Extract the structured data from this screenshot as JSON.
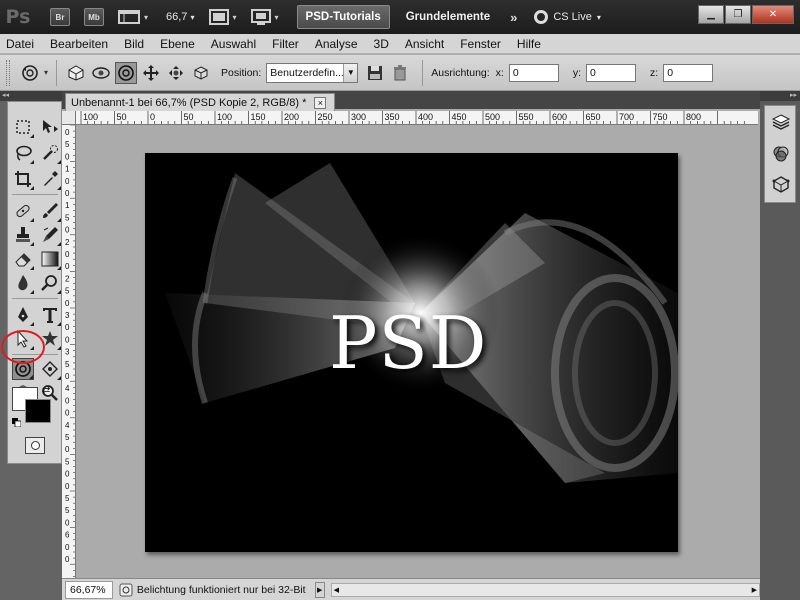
{
  "appbar": {
    "logo": "Ps",
    "bridge_label": "Br",
    "minibridge_label": "Mb",
    "zoom": "66,7",
    "workspace_active": "PSD-Tutorials",
    "workspace_next": "Grundelemente",
    "more": "»",
    "cslive": "CS Live",
    "chevron": "▾"
  },
  "menu": [
    "Datei",
    "Bearbeiten",
    "Bild",
    "Ebene",
    "Auswahl",
    "Filter",
    "Analyse",
    "3D",
    "Ansicht",
    "Fenster",
    "Hilfe"
  ],
  "options": {
    "position_label": "Position:",
    "position_value": "Benutzerdefin...",
    "orientation_label": "Ausrichtung:",
    "x_label": "x:",
    "x_value": "0",
    "y_label": "y:",
    "y_value": "0",
    "z_label": "z:",
    "z_value": "0"
  },
  "document": {
    "tab_title": "Unbenannt-1 bei 66,7% (PSD Kopie 2, RGB/8) *",
    "close": "×",
    "canvas_text": "PSD",
    "ruler_h": [
      "100",
      "50",
      "0",
      "50",
      "100",
      "150",
      "200",
      "250",
      "300",
      "350",
      "400",
      "450",
      "500",
      "550",
      "600",
      "650",
      "700",
      "750",
      "800"
    ],
    "ruler_v": [
      "0",
      "5",
      "0",
      "1",
      "0",
      "0",
      "1",
      "5",
      "0",
      "2",
      "0",
      "0",
      "2",
      "5",
      "0",
      "3",
      "0",
      "0",
      "3",
      "5",
      "0",
      "4",
      "0",
      "0",
      "4",
      "5",
      "0",
      "5",
      "0",
      "0",
      "5",
      "5",
      "0",
      "6",
      "0",
      "0"
    ]
  },
  "status": {
    "zoom": "66,67%",
    "text": "Belichtung funktioniert nur bei 32-Bit",
    "play": "▶",
    "left": "◀",
    "right": "▶"
  },
  "colors": {
    "foreground": "#ffffff",
    "background": "#000000",
    "highlight": "#e21b1b"
  }
}
